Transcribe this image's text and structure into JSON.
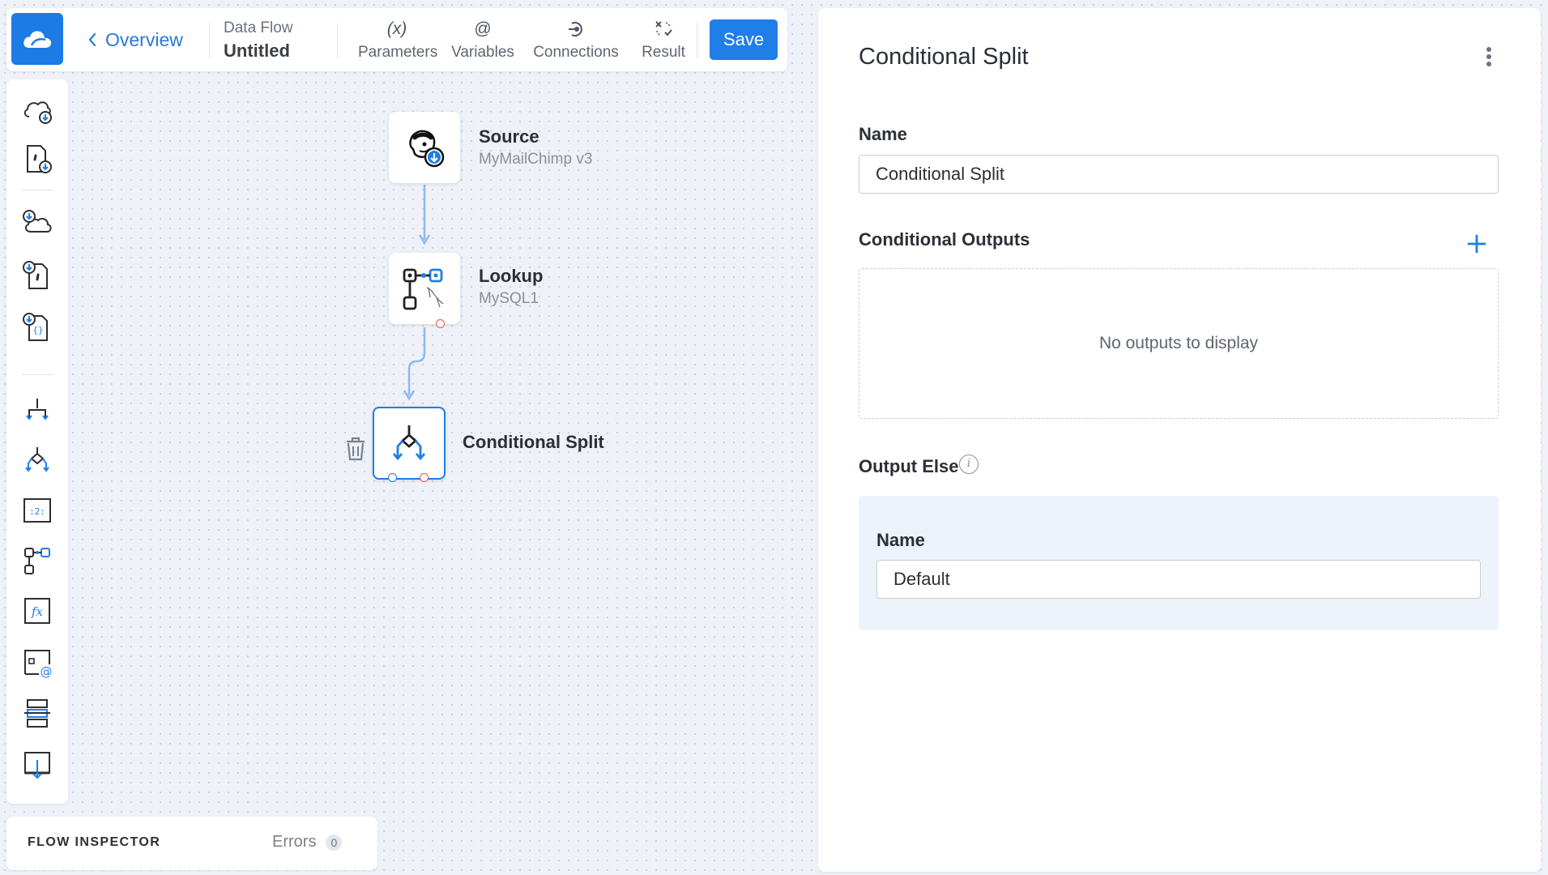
{
  "toolbar": {
    "back_label": "Overview",
    "flow_kicker": "Data Flow",
    "flow_name": "Untitled",
    "tools": [
      {
        "icon": "(x)",
        "label": "Parameters"
      },
      {
        "icon": "@",
        "label": "Variables"
      },
      {
        "icon": "connections-icon",
        "label": "Connections"
      },
      {
        "icon": "result-icon",
        "label": "Result"
      }
    ],
    "save_label": "Save"
  },
  "canvas": {
    "nodes": [
      {
        "title": "Source",
        "subtitle": "MyMailChimp v3",
        "icon": "mailchimp-source-icon"
      },
      {
        "title": "Lookup",
        "subtitle": "MySQL1",
        "icon": "lookup-mysql-icon"
      },
      {
        "title": "Conditional Split",
        "subtitle": "",
        "icon": "conditional-split-icon"
      }
    ]
  },
  "inspector": {
    "title": "FLOW INSPECTOR",
    "errors_label": "Errors",
    "errors_count": "0"
  },
  "panel": {
    "title": "Conditional Split",
    "name_label": "Name",
    "name_value": "Conditional Split",
    "outputs_label": "Conditional Outputs",
    "outputs_empty": "No outputs to display",
    "else_label": "Output Else",
    "else_name_label": "Name",
    "else_name_value": "Default"
  },
  "colors": {
    "accent": "#1f7ee8",
    "canvas_bg": "#eef2f8",
    "error_port": "#e4574a"
  }
}
